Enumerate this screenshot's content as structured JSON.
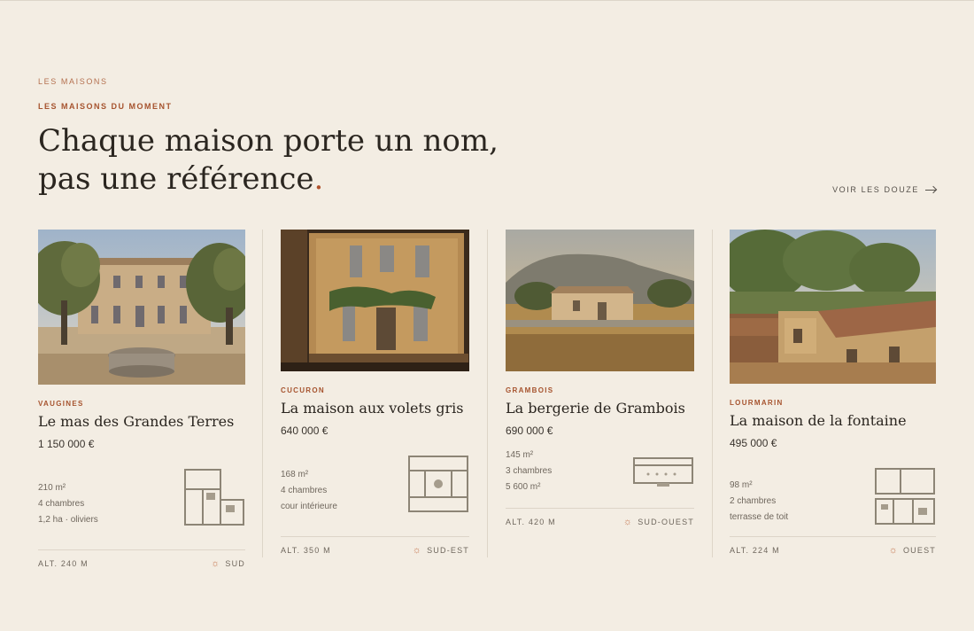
{
  "section": {
    "eyebrow": "LES MAISONS",
    "kicker": "LES MAISONS DU MOMENT",
    "headline_line1": "Chaque maison porte un nom,",
    "headline_line2": "pas une référence",
    "headline_dot": ".",
    "see_all_label": "VOIR LES DOUZE"
  },
  "colors": {
    "background": "#f3ede3",
    "accent": "#a6532e",
    "text": "#2b2620",
    "muted": "#6f675d"
  },
  "properties": [
    {
      "village": "VAUGINES",
      "title": "Le mas des Grandes Terres",
      "price": "1 150 000 €",
      "specs": [
        "210 m²",
        "4 chambres",
        "1,2 ha · oliviers"
      ],
      "altitude": "ALT. 240 M",
      "orientation": "SUD",
      "orientation_icon": "sun-icon"
    },
    {
      "village": "CUCURON",
      "title": "La maison aux volets gris",
      "price": "640 000 €",
      "specs": [
        "168 m²",
        "4 chambres",
        "cour intérieure"
      ],
      "altitude": "ALT. 350 M",
      "orientation": "SUD-EST",
      "orientation_icon": "sun-icon"
    },
    {
      "village": "GRAMBOIS",
      "title": "La bergerie de Grambois",
      "price": "690 000 €",
      "specs": [
        "145 m²",
        "3 chambres",
        "5 600 m²"
      ],
      "altitude": "ALT. 420 M",
      "orientation": "SUD-OUEST",
      "orientation_icon": "sun-icon"
    },
    {
      "village": "LOURMARIN",
      "title": "La maison de la fontaine",
      "price": "495 000 €",
      "specs": [
        "98 m²",
        "2 chambres",
        "terrasse de toit"
      ],
      "altitude": "ALT. 224 M",
      "orientation": "OUEST",
      "orientation_icon": "sun-icon"
    }
  ]
}
